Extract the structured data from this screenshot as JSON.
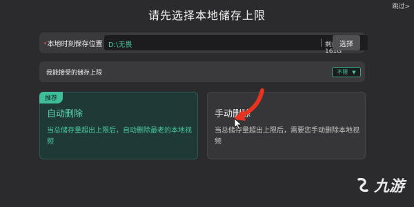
{
  "header": {
    "skip_label": "跳过>",
    "title": "请先选择本地储存上限"
  },
  "save_location": {
    "required_mark": "*",
    "label": "本地时刻保存位置",
    "path_value": "D:\\无畏",
    "free_space": "剩余空间 161G",
    "choose_label": "选择"
  },
  "storage_limit": {
    "label": "我能接受的储存上限",
    "selected": "不限"
  },
  "options": [
    {
      "badge": "推荐",
      "title": "自动删除",
      "description": "当总储存量超出上限后，自动删除最老的本地视频",
      "selected": true
    },
    {
      "title": "手动删除",
      "description": "当总储存量超出上限后，需要您手动删除本地视频",
      "selected": false
    }
  ],
  "watermark": {
    "text": "九游"
  },
  "colors": {
    "accent": "#45c4a2",
    "annotation_arrow": "#e8331f",
    "background": "#2b2b2d"
  }
}
